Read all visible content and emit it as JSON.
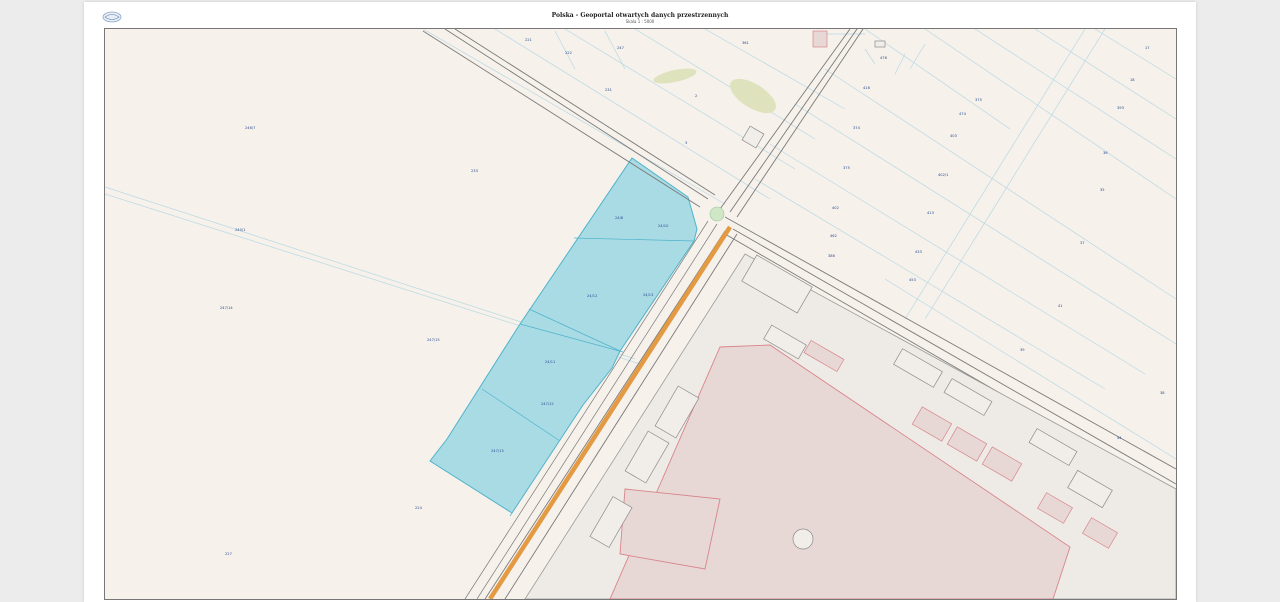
{
  "header": {
    "title": "Polska - Geoportal otwartych danych przestrzennych",
    "scale": "Skala 1 : 5000"
  },
  "map": {
    "colors": {
      "background": "#f6f1ea",
      "parcel_line": "#7fc4dc",
      "highlight_fill": "#a9dbe4",
      "highlight_stroke": "#4fb3cc",
      "road_edge": "#7a7a7a",
      "main_road": "#e39a42",
      "building_fill": "#e7d8d6",
      "building_stroke": "#d8858b",
      "meadow": "#dfe3bd"
    },
    "highlighted_parcels": [
      "24/10",
      "24/11",
      "24/8",
      "24/9",
      "24/12",
      "24/13",
      "24/11"
    ],
    "parcel_labels": [
      "246/7",
      "240/1",
      "24/8",
      "24/10",
      "24/12",
      "24/13",
      "24/11",
      "247/12",
      "247/13",
      "247/14",
      "247/15",
      "224",
      "227",
      "233",
      "231",
      "2",
      "3",
      "221",
      "222",
      "247",
      "361",
      "374",
      "375",
      "402",
      "416",
      "413",
      "433",
      "462",
      "402/1",
      "403",
      "453",
      "474",
      "375",
      "476",
      "386",
      "393",
      "35",
      "37",
      "36",
      "18",
      "44",
      "41",
      "39",
      "38",
      "17"
    ]
  }
}
